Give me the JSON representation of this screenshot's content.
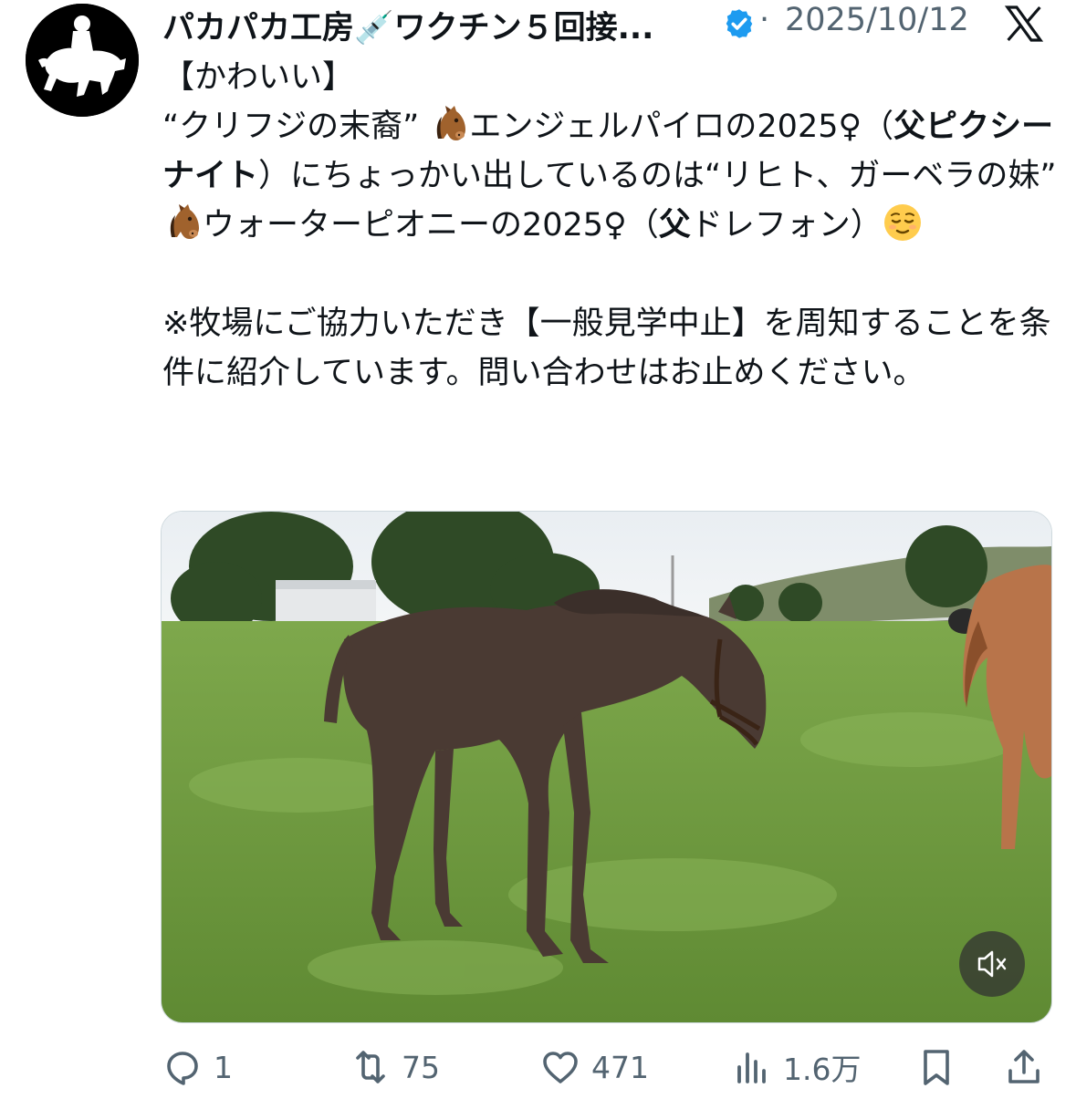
{
  "tweet": {
    "display_name": "パカパカ工房💉ワクチン５回接...",
    "separator": "·",
    "date": "2025/10/12",
    "text": {
      "line_tag": "【かわいい】",
      "p1_a": "“クリフジの末裔” ",
      "p1_b": "エンジェルパイロの2025♀（",
      "p1_bold1": "父ピクシーナイト",
      "p1_c": "）にちょっかい出しているのは“リヒト、ガーベラの妹” ",
      "p1_d": "ウォーターピオニーの2025♀（",
      "p1_bold2": "父",
      "p1_e": "ドレフォン）",
      "p2": "※牧場にご協力いただき【一般見学中止】を周知することを条件に紹介しています。問い合わせはお止めください。"
    },
    "stats": {
      "replies": "1",
      "retweets": "75",
      "likes": "471",
      "views": "1.6万"
    }
  },
  "colors": {
    "verified": "#1d9bf0",
    "muted_text": "#536471",
    "grass": "#6f9a3f",
    "horse_dark": "#4a3a33",
    "horse_chestnut": "#b8744a"
  }
}
